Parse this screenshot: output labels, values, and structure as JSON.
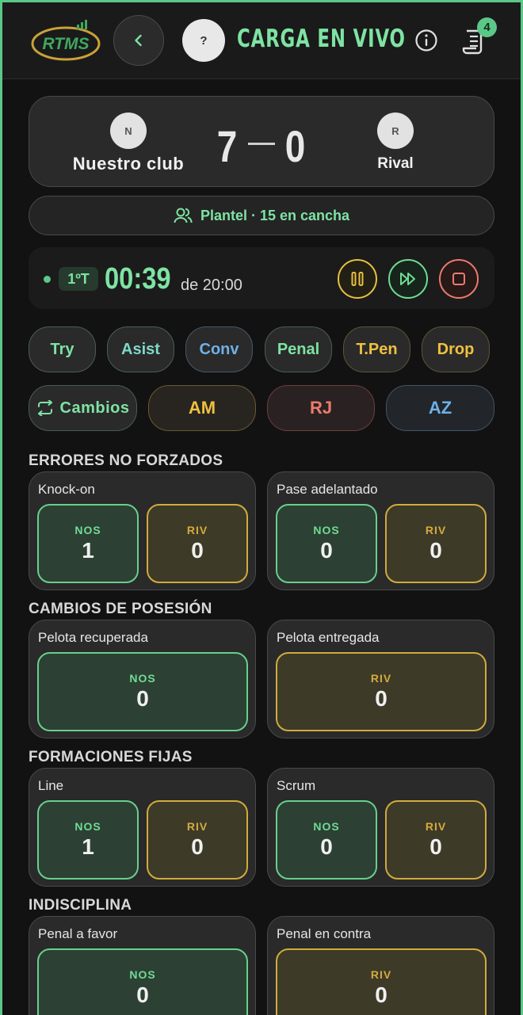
{
  "header": {
    "logo_text": "RTMS",
    "title": "CARGA EN VIVO",
    "avatar_initial": "?",
    "notifications_count": "4"
  },
  "scoreboard": {
    "home": {
      "initial": "N",
      "name": "Nuestro club",
      "score": "7"
    },
    "away": {
      "initial": "R",
      "name": "Rival",
      "score": "0"
    }
  },
  "plantel": {
    "label": "Plantel · 15 en cancha"
  },
  "timer": {
    "period": "1ºT",
    "elapsed": "00:39",
    "total": "de 20:00"
  },
  "scoring_actions": [
    "Try",
    "Asist",
    "Conv",
    "Penal",
    "T.Pen",
    "Drop"
  ],
  "other_actions": {
    "changes": "Cambios",
    "cards": [
      "AM",
      "RJ",
      "AZ"
    ]
  },
  "sections": [
    {
      "title": "ERRORES NO FORZADOS",
      "cards": [
        {
          "label": "Knock-on",
          "nos": "1",
          "riv": "0"
        },
        {
          "label": "Pase adelantado",
          "nos": "0",
          "riv": "0"
        }
      ]
    },
    {
      "title": "CAMBIOS DE POSESIÓN",
      "cards": [
        {
          "label": "Pelota recuperada",
          "nos": "0"
        },
        {
          "label": "Pelota entregada",
          "riv": "0"
        }
      ]
    },
    {
      "title": "FORMACIONES FIJAS",
      "cards": [
        {
          "label": "Line",
          "nos": "1",
          "riv": "0"
        },
        {
          "label": "Scrum",
          "nos": "0",
          "riv": "0"
        }
      ]
    },
    {
      "title": "INDISCIPLINA",
      "cards": [
        {
          "label": "Penal a favor",
          "nos": "0"
        },
        {
          "label": "Penal en contra",
          "riv": "0"
        }
      ]
    }
  ],
  "labels": {
    "nos": "NOS",
    "riv": "RIV"
  },
  "colors": {
    "accent_green": "#7ee3a3",
    "accent_yellow": "#f0c040",
    "accent_red": "#ec7b6e",
    "accent_blue": "#6fb0e8",
    "background": "#121212"
  }
}
